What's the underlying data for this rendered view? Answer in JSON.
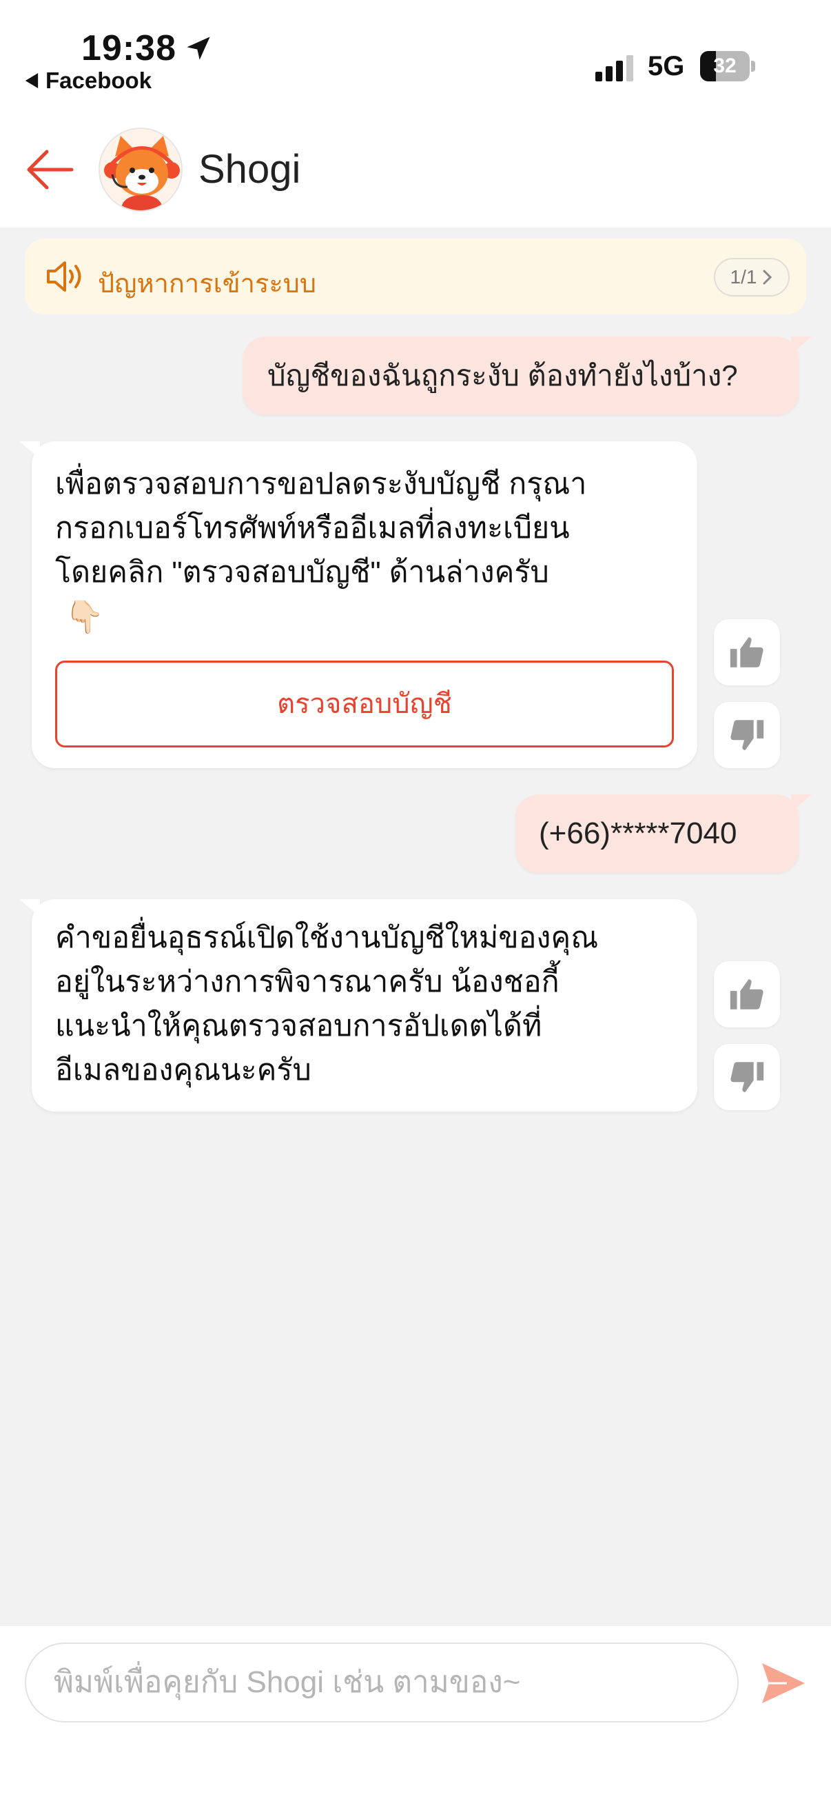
{
  "status_bar": {
    "time": "19:38",
    "back_app": "Facebook",
    "network": "5G",
    "battery": "32",
    "battery_level": 0.32
  },
  "header": {
    "title": "Shogi"
  },
  "announcement": {
    "text": "ปัญหาการเข้าระบบ",
    "pager": "1/1"
  },
  "messages": [
    {
      "from": "user",
      "text": "บัญชีของฉันถูกระงับ ต้องทำยังไงบ้าง?"
    },
    {
      "from": "bot",
      "lines": [
        "เพื่อตรวจสอบการขอปลดระงับบัญชี กรุณา",
        "กรอกเบอร์โทรศัพท์หรืออีเมลที่ลงทะเบียน",
        "โดยคลิก \"ตรวจสอบบัญชี\" ด้านล่างครับ"
      ],
      "emoji": "👇🏻",
      "button": "ตรวจสอบบัญชี"
    },
    {
      "from": "user",
      "text": "(+66)*****7040"
    },
    {
      "from": "bot",
      "lines": [
        "คำขอยื่นอุธรณ์เปิดใช้งานบัญชีใหม่ของคุณ",
        "อยู่ในระหว่างการพิจารณาครับ น้องชอกี้",
        "แนะนำให้คุณตรวจสอบการอัปเดตได้ที่",
        "อีเมลของคุณนะครับ"
      ]
    }
  ],
  "input": {
    "placeholder": "พิมพ์เพื่อคุยกับ Shogi เช่น ตามของ~",
    "value": ""
  },
  "colors": {
    "accent": "#e8432f",
    "notice_bg": "#fff7e6",
    "notice_text": "#d9730d",
    "user_bubble": "#fde5df",
    "send": "#f7a58f"
  },
  "icons": {
    "back": "arrow-left-icon",
    "speaker": "speaker-icon",
    "thumbs_up": "thumbs-up-icon",
    "thumbs_down": "thumbs-down-icon",
    "send": "send-icon",
    "location": "location-arrow-icon"
  }
}
